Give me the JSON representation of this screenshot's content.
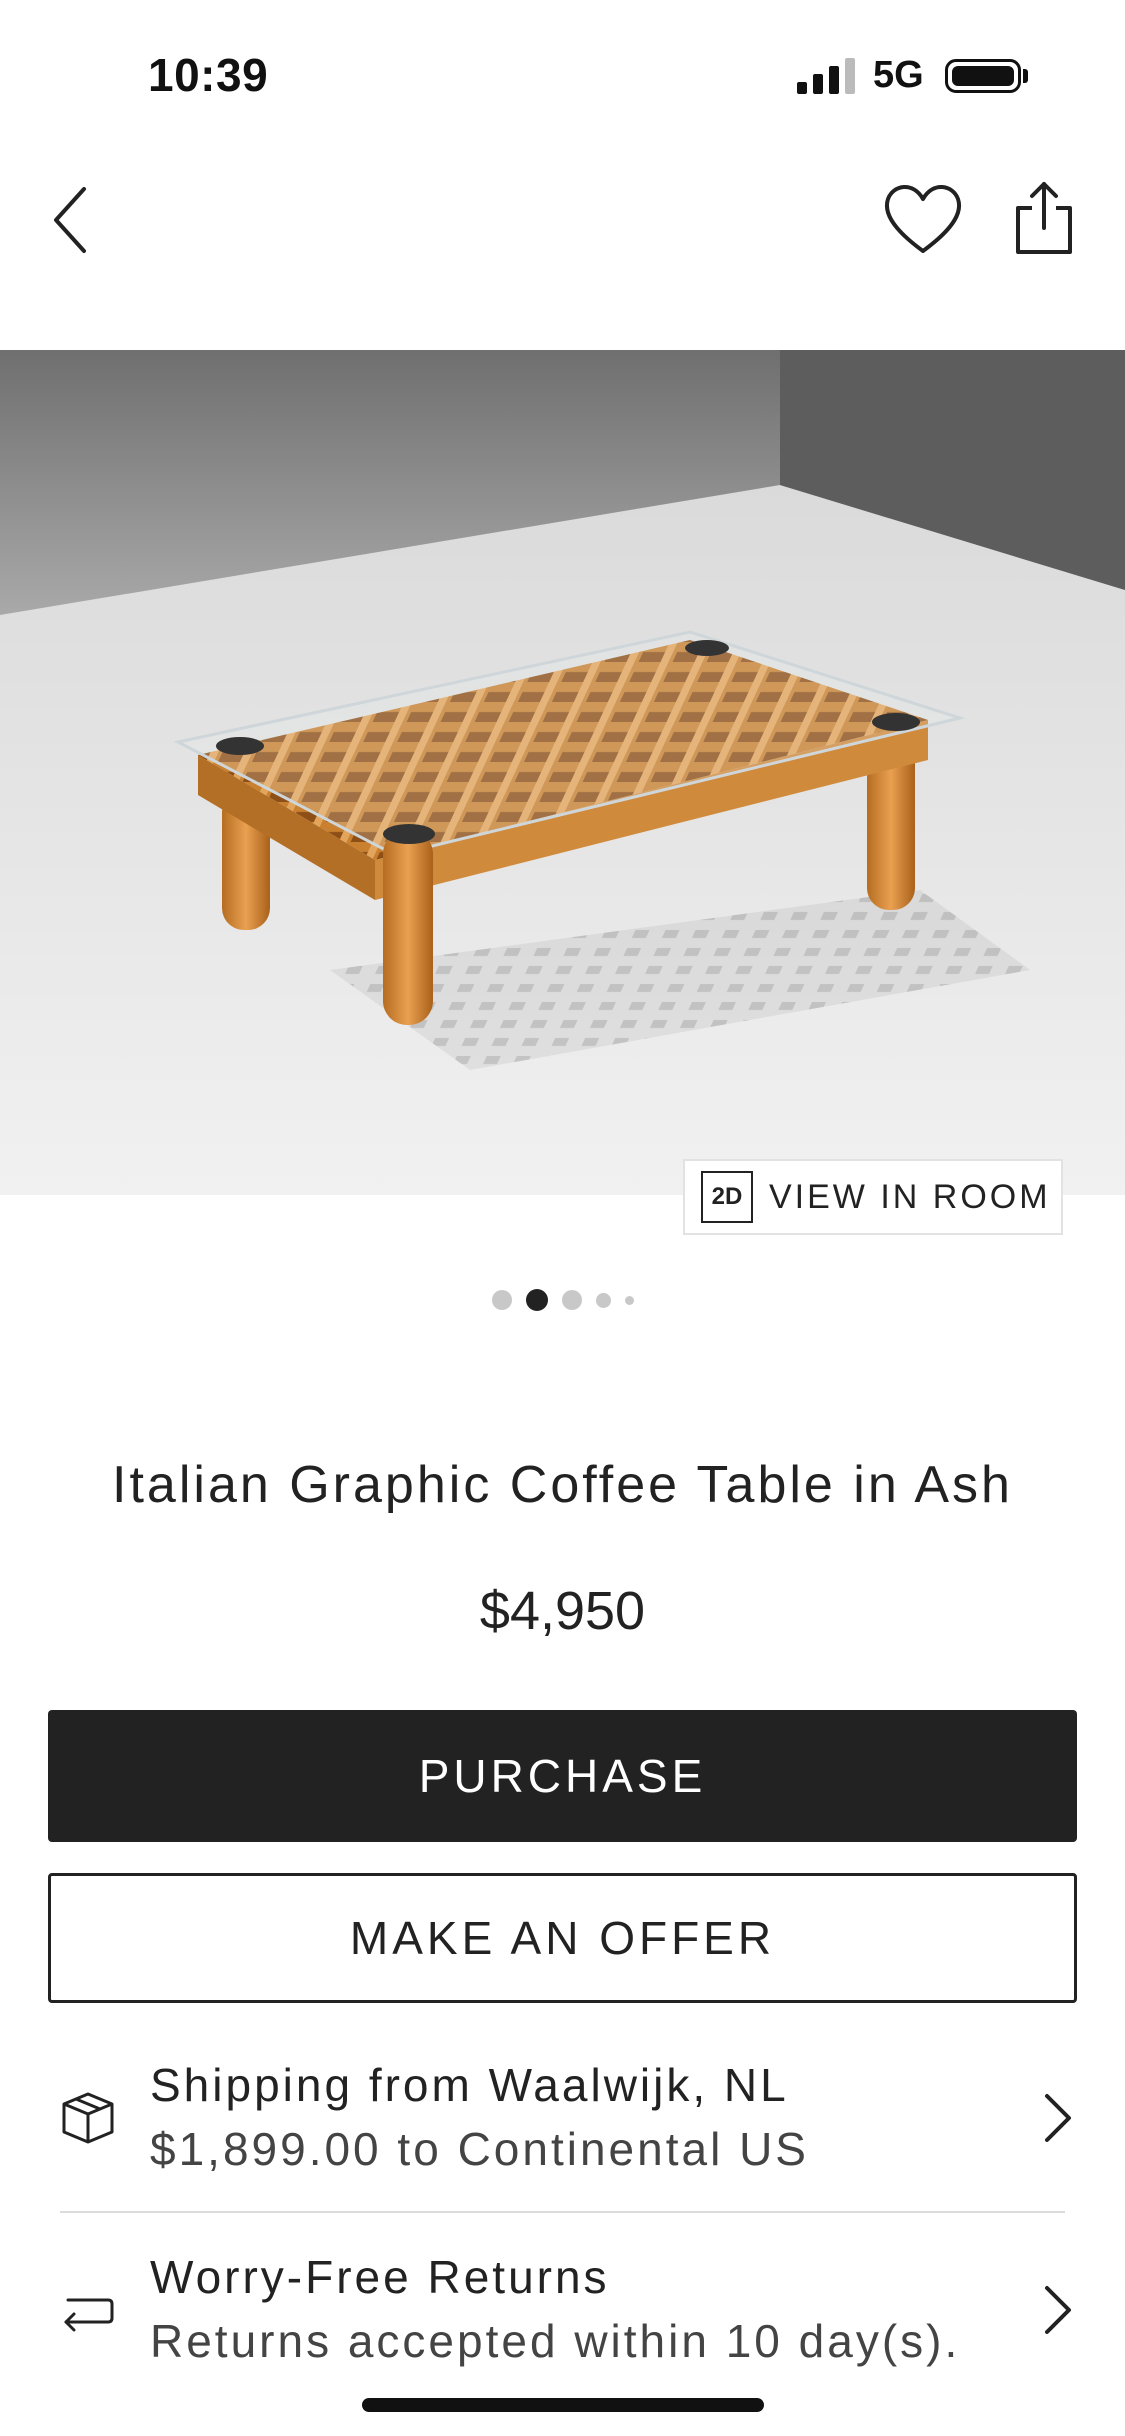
{
  "status_bar": {
    "time": "10:39",
    "network": "5G"
  },
  "nav": {
    "back_icon": "chevron-left-icon",
    "favorite_icon": "heart-icon",
    "share_icon": "share-icon"
  },
  "gallery": {
    "image_alt": "Italian Graphic Coffee Table in Ash",
    "view_in_room_badge": "2D",
    "view_in_room_label": "VIEW IN ROOM",
    "active_index": 1,
    "dot_count": 5
  },
  "product": {
    "title": "Italian Graphic Coffee Table in Ash",
    "price": "$4,950"
  },
  "actions": {
    "purchase_label": "PURCHASE",
    "offer_label": "MAKE AN OFFER"
  },
  "shipping": {
    "icon": "package-icon",
    "title": "Shipping from Waalwijk, NL",
    "detail": "$1,899.00 to Continental US"
  },
  "returns": {
    "icon": "return-arrow-icon",
    "title": "Worry-Free Returns",
    "detail": "Returns accepted within 10 day(s)."
  },
  "colors": {
    "primary_button": "#222222",
    "text": "#222222"
  }
}
